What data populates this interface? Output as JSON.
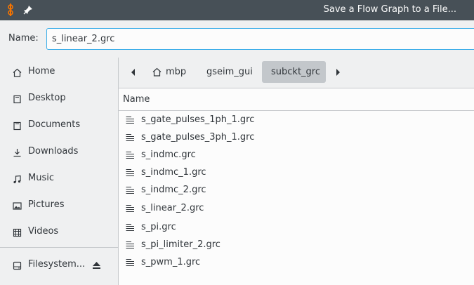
{
  "window": {
    "title": "Save a Flow Graph to a File..."
  },
  "name_field": {
    "label": "Name:",
    "value": "s_linear_2.grc"
  },
  "places": [
    {
      "label": "Home",
      "icon": "home-icon"
    },
    {
      "label": "Desktop",
      "icon": "desktop-icon"
    },
    {
      "label": "Documents",
      "icon": "documents-icon"
    },
    {
      "label": "Downloads",
      "icon": "downloads-icon"
    },
    {
      "label": "Music",
      "icon": "music-icon"
    },
    {
      "label": "Pictures",
      "icon": "pictures-icon"
    },
    {
      "label": "Videos",
      "icon": "videos-icon"
    }
  ],
  "devices": [
    {
      "label": "Filesystem...",
      "icon": "filesystem-icon"
    }
  ],
  "breadcrumbs": [
    {
      "label": "mbp",
      "icon": "home-icon"
    },
    {
      "label": "gseim_gui"
    },
    {
      "label": "subckt_grc",
      "active": true
    }
  ],
  "file_list": {
    "column_header": "Name",
    "files": [
      "s_gate_pulses_1ph_1.grc",
      "s_gate_pulses_3ph_1.grc",
      "s_indmc.grc",
      "s_indmc_1.grc",
      "s_indmc_2.grc",
      "s_linear_2.grc",
      "s_pi.grc",
      "s_pi_limiter_2.grc",
      "s_pwm_1.grc"
    ]
  },
  "colors": {
    "titlebar": "#475057",
    "accent": "#3daee9",
    "active_crumb": "#c3c7cb",
    "window_bg": "#eff0f1",
    "list_bg": "#fcfcfc"
  }
}
